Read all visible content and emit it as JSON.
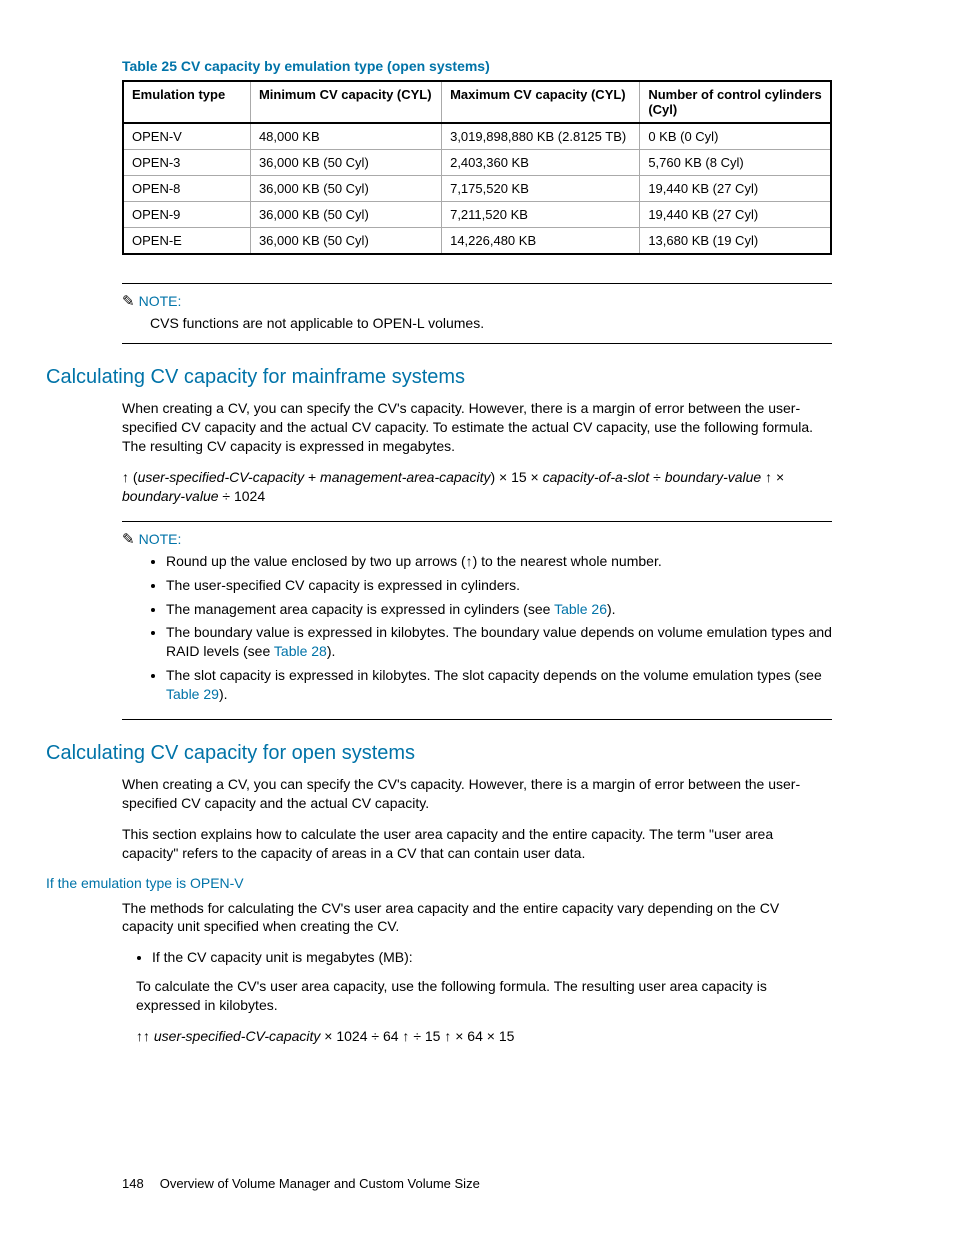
{
  "table": {
    "caption": "Table 25 CV capacity by emulation type (open systems)",
    "headers": [
      "Emulation type",
      "Minimum CV capacity (CYL)",
      "Maximum CV capacity (CYL)",
      "Number of control cylinders (Cyl)"
    ],
    "rows": [
      [
        "OPEN-V",
        "48,000 KB",
        "3,019,898,880 KB (2.8125 TB)",
        "0 KB (0 Cyl)"
      ],
      [
        "OPEN-3",
        "36,000 KB (50 Cyl)",
        "2,403,360 KB",
        "5,760 KB (8 Cyl)"
      ],
      [
        "OPEN-8",
        "36,000 KB (50 Cyl)",
        "7,175,520 KB",
        "19,440 KB (27 Cyl)"
      ],
      [
        "OPEN-9",
        "36,000 KB (50 Cyl)",
        "7,211,520 KB",
        "19,440 KB (27 Cyl)"
      ],
      [
        "OPEN-E",
        "36,000 KB (50 Cyl)",
        "14,226,480 KB",
        "13,680 KB (19 Cyl)"
      ]
    ]
  },
  "note1": {
    "label": "NOTE:",
    "text": "CVS functions are not applicable to OPEN-L volumes."
  },
  "section1": {
    "title": "Calculating CV capacity for mainframe systems",
    "p1": "When creating a CV, you can specify the CV's capacity. However, there is a margin of error between the user-specified CV capacity and the actual CV capacity. To estimate the actual CV capacity, use the following formula. The resulting CV capacity is expressed in megabytes.",
    "formula_a": "↑ (",
    "formula_b": "user-specified-CV-capacity",
    "formula_c": " + ",
    "formula_d": "management-area-capacity",
    "formula_e": ") × 15 × ",
    "formula_f": "capacity-of-a-slot",
    "formula_g": " ÷ ",
    "formula_h": "boundary-value",
    "formula_i": " ↑ × ",
    "formula_j": "boundary-value",
    "formula_k": " ÷ 1024"
  },
  "note2": {
    "label": "NOTE:",
    "items": [
      {
        "pre": "Round up the value enclosed by two up arrows (↑) to the nearest whole number.",
        "link": "",
        "post": ""
      },
      {
        "pre": "The user-specified CV capacity is expressed in cylinders.",
        "link": "",
        "post": ""
      },
      {
        "pre": "The management area capacity is expressed in cylinders (see ",
        "link": "Table 26",
        "post": ")."
      },
      {
        "pre": "The boundary value is expressed in kilobytes. The boundary value depends on volume emulation types and RAID levels (see ",
        "link": "Table 28",
        "post": ")."
      },
      {
        "pre": "The slot capacity is expressed in kilobytes. The slot capacity depends on the volume emulation types (see ",
        "link": "Table 29",
        "post": ")."
      }
    ]
  },
  "section2": {
    "title": "Calculating CV capacity for open systems",
    "p1": "When creating a CV, you can specify the CV's capacity. However, there is a margin of error between the user-specified CV capacity and the actual CV capacity.",
    "p2": "This section explains how to calculate the user area capacity and the entire capacity. The term \"user area capacity\" refers to the capacity of areas in a CV that can contain user data."
  },
  "sub1": {
    "title": "If the emulation type is OPEN-V",
    "p1": "The methods for calculating the CV's user area capacity and the entire capacity vary depending on the CV capacity unit specified when creating the CV.",
    "bullet": "If the CV capacity unit is megabytes (MB):",
    "b_p1": "To calculate the CV's user area capacity, use the following formula. The resulting user area capacity is expressed in kilobytes.",
    "formula_a": "↑↑ ",
    "formula_b": "user-specified-CV-capacity",
    "formula_c": " × 1024 ÷ 64 ↑ ÷ 15 ↑ × 64 × 15"
  },
  "footer": {
    "page": "148",
    "title": "Overview of Volume Manager and Custom Volume Size"
  }
}
